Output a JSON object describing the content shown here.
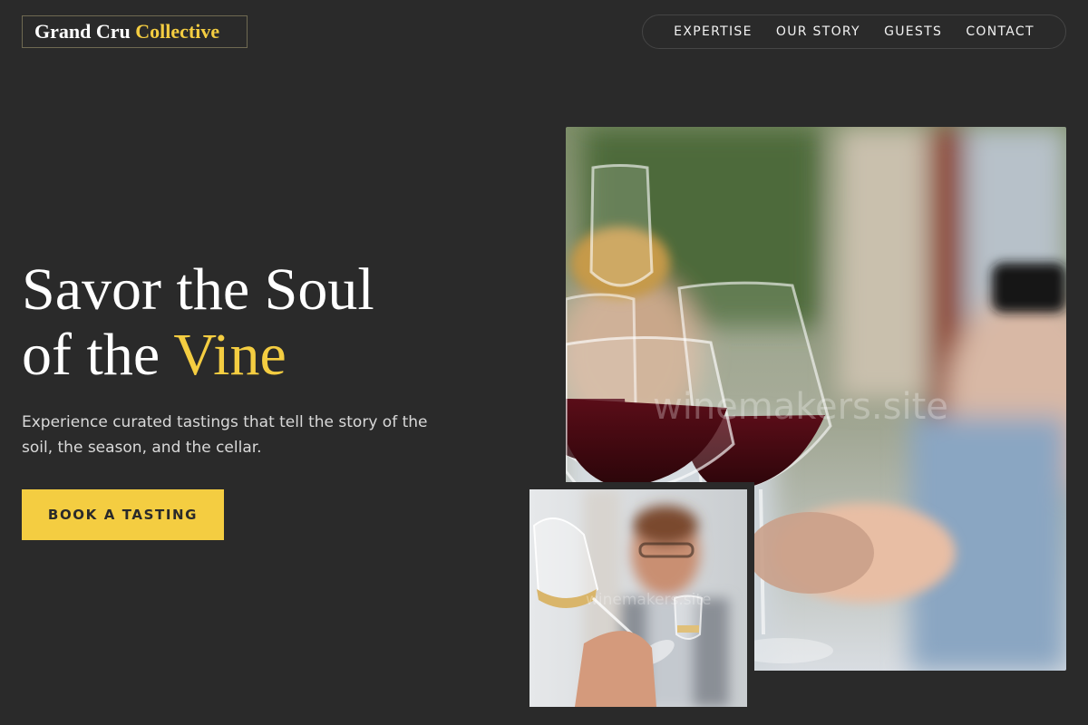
{
  "brand": {
    "name_part1": "Grand Cru",
    "name_part2": "Collective"
  },
  "nav": {
    "items": [
      {
        "label": "EXPERTISE"
      },
      {
        "label": "OUR STORY"
      },
      {
        "label": "GUESTS"
      },
      {
        "label": "CONTACT"
      }
    ]
  },
  "hero": {
    "headline_line1": "Savor the Soul",
    "headline_line2_plain": "of the ",
    "headline_line2_accent": "Vine",
    "subtitle": "Experience curated tastings that tell the story of the soil, the season, and the cellar.",
    "cta_label": "BOOK A TASTING"
  },
  "images": {
    "main": {
      "alt": "Friends toasting with glasses of red wine",
      "watermark": "winemakers.site"
    },
    "small": {
      "alt": "Smiling man examining a glass of white wine",
      "watermark": "winemakers.site"
    }
  },
  "colors": {
    "background": "#2a2a2a",
    "accent": "#f4cd41",
    "text": "#ffffff",
    "muted_text": "#d9d9d9"
  }
}
